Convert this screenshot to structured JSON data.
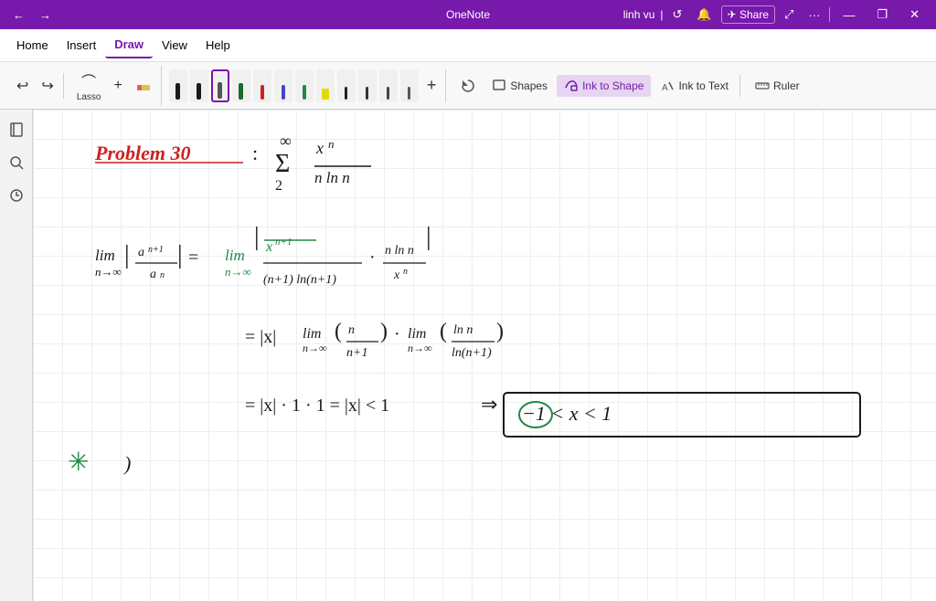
{
  "titlebar": {
    "back_label": "←",
    "forward_label": "→",
    "title": "OneNote",
    "user": "linh vu",
    "separator": "|",
    "refresh_icon": "↺",
    "bell_icon": "🔔",
    "share_label": "Share",
    "expand_icon": "⤢",
    "more_icon": "···",
    "minimize_label": "—",
    "restore_label": "❐",
    "close_label": "✕"
  },
  "menubar": {
    "items": [
      "Home",
      "Insert",
      "Draw",
      "View",
      "Help"
    ]
  },
  "toolbar": {
    "undo_label": "↩",
    "redo_label": "↪",
    "lasso_label": "⌒",
    "eraser_plus_label": "+",
    "eraser_label": "✕",
    "pens": [
      {
        "color": "#1a1a1a",
        "label": "Black pen"
      },
      {
        "color": "#1a1a1a",
        "label": "Black pen 2"
      },
      {
        "color": "#555555",
        "label": "Gray pen",
        "selected": true
      },
      {
        "color": "#1a6b2a",
        "label": "Dark green pen"
      },
      {
        "color": "#cc2222",
        "label": "Red pen"
      },
      {
        "color": "#4444cc",
        "label": "Blue pen"
      },
      {
        "color": "#228844",
        "label": "Green pen"
      },
      {
        "color": "#dddd00",
        "label": "Yellow pen"
      },
      {
        "color": "#222222",
        "label": "Black pen 3"
      },
      {
        "color": "#333333",
        "label": "Dark pen"
      },
      {
        "color": "#444444",
        "label": "Dark pen 2"
      },
      {
        "color": "#555566",
        "label": "Indigo pen"
      }
    ],
    "add_label": "+",
    "ink_replay_label": "↺",
    "shapes_label": "Shapes",
    "ink_to_shape_label": "Ink to Shape",
    "ink_to_text_label": "Ink to Text",
    "ruler_label": "Ruler"
  },
  "sidebar": {
    "icons": [
      "≡",
      "🔍",
      "🕐"
    ]
  },
  "note": {
    "problem_label": "Problem 30",
    "math_content": "Handwritten math"
  },
  "colors": {
    "titlebar_bg": "#7719aa",
    "active_menu": "#7719aa",
    "canvas_bg": "#ffffff",
    "grid_line": "#c8d8e8"
  }
}
